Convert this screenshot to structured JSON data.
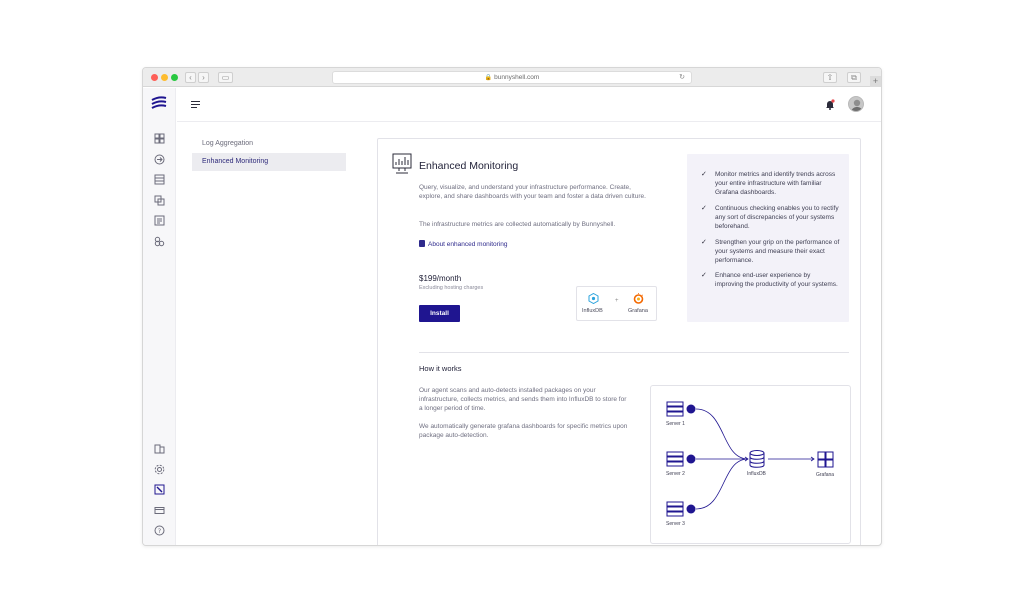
{
  "browser": {
    "url": "bunnyshell.com"
  },
  "sidebar_menu": [
    {
      "label": "Log Aggregation"
    },
    {
      "label": "Enhanced Monitoring"
    }
  ],
  "panel": {
    "title": "Enhanced Monitoring",
    "description": "Query, visualize, and understand your infrastructure performance. Create, explore, and share dashboards with your team and foster a data driven culture.",
    "auto_note": "The infrastructure metrics are collected automatically by Bunnyshell.",
    "about_link": "About enhanced monitoring",
    "price": "$199/month",
    "price_note": "Excluding hosting charges",
    "install_label": "Install",
    "integrations": {
      "left": "InfluxDB",
      "plus": "+",
      "right": "Grafana"
    },
    "features": [
      "Monitor metrics and identify trends across your entire infrastructure with familiar Grafana dashboards.",
      "Continuous checking enables you to rectify any sort of discrepancies of your systems beforehand.",
      "Strengthen your grip on the performance of your systems and measure their exact performance.",
      "Enhance end-user experience  by improving the productivity of your systems."
    ],
    "how_title": "How it works",
    "how_p1": "Our agent scans and auto-detects installed packages on your infrastructure, collects metrics, and sends them into InfluxDB to store for a longer period of time.",
    "how_p2": "We automatically generate grafana dashboards for specific metrics upon package auto-detection.",
    "diagram": {
      "server1": "Server 1",
      "server2": "Server 2",
      "server3": "Server 3",
      "influx": "InfluxDB",
      "grafana": "Grafana"
    }
  },
  "colors": {
    "accent": "#1f1590",
    "feature_bg": "#f3f2f9"
  }
}
